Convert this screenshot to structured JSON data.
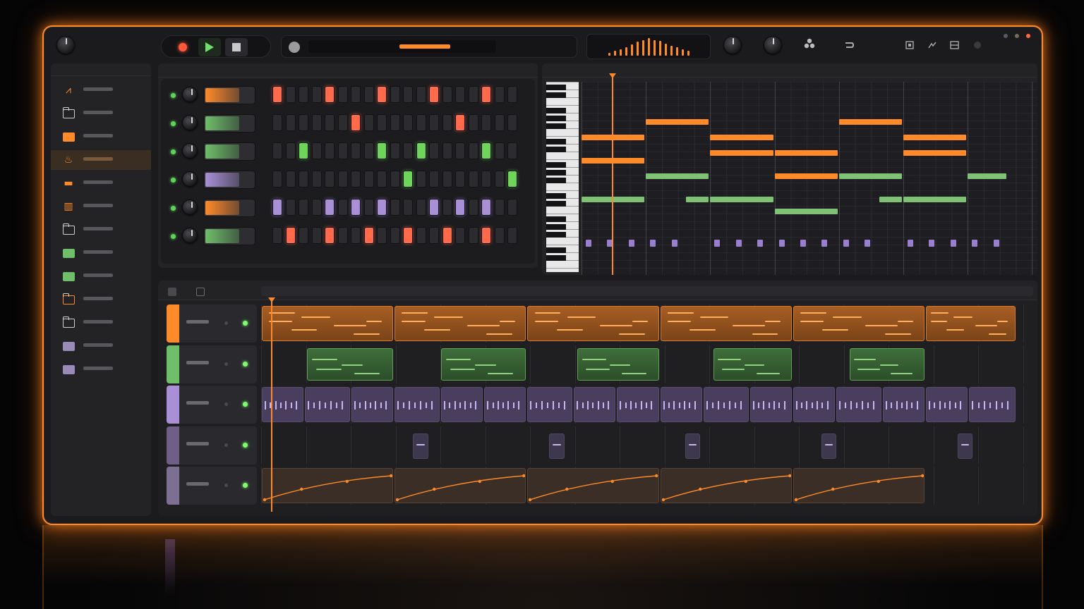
{
  "app": {
    "title": ""
  },
  "colors": {
    "accent": "#ff8a2a",
    "green": "#6fbe6a",
    "purple": "#a88fd6",
    "red": "#ff6b4a",
    "panel": "#232326"
  },
  "transport": {
    "record_icon": "record-icon",
    "play_icon": "play-icon",
    "stop_icon": "stop-icon",
    "position_fraction": 0.62
  },
  "toolbar": {
    "icons": [
      "knob-icon",
      "knob-icon",
      "nodes-icon",
      "loop-icon",
      "window-icon",
      "edit-icon",
      "layout-icon",
      "settings-icon"
    ]
  },
  "meter": {
    "levels": [
      0.15,
      0.25,
      0.35,
      0.45,
      0.6,
      0.75,
      0.85,
      0.95,
      0.85,
      0.8,
      0.65,
      0.55,
      0.45,
      0.35,
      0.25
    ]
  },
  "sidebar": {
    "items": [
      {
        "icon": "waveform-icon",
        "label": "",
        "active": false
      },
      {
        "icon": "folder-icon",
        "label": "",
        "active": false
      },
      {
        "icon": "folder-filled-icon",
        "label": "",
        "active": false
      },
      {
        "icon": "instrument-icon",
        "label": "",
        "active": true
      },
      {
        "icon": "drum-icon",
        "label": "",
        "active": false
      },
      {
        "icon": "piano-icon",
        "label": "",
        "active": false
      },
      {
        "icon": "folder-icon",
        "label": "",
        "active": false
      },
      {
        "icon": "folder-filled-icon",
        "label": "",
        "active": false
      },
      {
        "icon": "folder-filled-icon",
        "label": "",
        "active": false
      },
      {
        "icon": "folder-icon",
        "label": "",
        "active": false
      },
      {
        "icon": "folder-icon",
        "label": "",
        "active": false
      },
      {
        "icon": "folder-filled-icon",
        "label": "",
        "active": false
      },
      {
        "icon": "folder-filled-icon",
        "label": "",
        "active": false
      }
    ]
  },
  "step_sequencer": {
    "channels": [
      {
        "color": "#ff8a2a",
        "steps": [
          1,
          0,
          0,
          0,
          1,
          0,
          0,
          0,
          1,
          0,
          0,
          0,
          1,
          0,
          0,
          0,
          1,
          0,
          0
        ],
        "step_color": "#ff6b4a"
      },
      {
        "color": "#6fbe6a",
        "steps": [
          0,
          0,
          0,
          0,
          0,
          0,
          1,
          0,
          0,
          0,
          0,
          0,
          0,
          0,
          1,
          0,
          0,
          0,
          0
        ],
        "step_color": "#ff6b4a"
      },
      {
        "color": "#6fbe6a",
        "steps": [
          0,
          0,
          1,
          0,
          0,
          0,
          0,
          0,
          1,
          0,
          0,
          1,
          0,
          0,
          0,
          0,
          1,
          0,
          0
        ],
        "step_color": "#6fd45a"
      },
      {
        "color": "#a88fd6",
        "steps": [
          0,
          0,
          0,
          0,
          0,
          0,
          0,
          0,
          0,
          0,
          1,
          0,
          0,
          0,
          0,
          0,
          0,
          0,
          1
        ],
        "step_color": "#6fd45a"
      },
      {
        "color": "#ff8a2a",
        "steps": [
          1,
          0,
          0,
          0,
          1,
          0,
          1,
          0,
          1,
          0,
          0,
          0,
          1,
          0,
          1,
          0,
          1,
          0,
          0
        ],
        "step_color": "#a88fd6"
      },
      {
        "color": "#6fbe6a",
        "steps": [
          0,
          1,
          0,
          0,
          1,
          0,
          0,
          1,
          0,
          0,
          1,
          0,
          0,
          1,
          0,
          0,
          1,
          0,
          0
        ],
        "step_color": "#ff6b4a"
      }
    ]
  },
  "piano_roll": {
    "notes": [
      {
        "start": 0,
        "len": 4,
        "row": 7,
        "color": "#ff8a2a"
      },
      {
        "start": 4,
        "len": 4,
        "row": 5,
        "color": "#ff8a2a"
      },
      {
        "start": 8,
        "len": 4,
        "row": 7,
        "color": "#ff8a2a"
      },
      {
        "start": 8,
        "len": 4,
        "row": 9,
        "color": "#ff8a2a"
      },
      {
        "start": 12,
        "len": 4,
        "row": 9,
        "color": "#ff8a2a"
      },
      {
        "start": 12,
        "len": 4,
        "row": 12,
        "color": "#ff8a2a"
      },
      {
        "start": 16,
        "len": 4,
        "row": 5,
        "color": "#ff8a2a"
      },
      {
        "start": 20,
        "len": 4,
        "row": 7,
        "color": "#ff8a2a"
      },
      {
        "start": 20,
        "len": 4,
        "row": 9,
        "color": "#ff8a2a"
      },
      {
        "start": 0,
        "len": 4,
        "row": 10,
        "color": "#ff8a2a"
      },
      {
        "start": 4,
        "len": 4,
        "row": 12,
        "color": "#7fc275"
      },
      {
        "start": 16,
        "len": 4,
        "row": 12,
        "color": "#7fc275"
      },
      {
        "start": 24,
        "len": 2.5,
        "row": 12,
        "color": "#7fc275"
      },
      {
        "start": 0,
        "len": 4,
        "row": 15,
        "color": "#7fc275"
      },
      {
        "start": 6.5,
        "len": 1.5,
        "row": 15,
        "color": "#7fc275"
      },
      {
        "start": 8,
        "len": 4,
        "row": 15,
        "color": "#7fc275"
      },
      {
        "start": 12,
        "len": 4,
        "row": 16.5,
        "color": "#7fc275"
      },
      {
        "start": 18.5,
        "len": 1.5,
        "row": 15,
        "color": "#7fc275"
      },
      {
        "start": 20,
        "len": 4,
        "row": 15,
        "color": "#7fc275"
      }
    ],
    "hits": [
      0,
      1.33,
      2.66,
      4,
      5.33,
      8,
      9.33,
      10.66,
      12,
      13.33,
      14.66,
      16,
      17.33,
      20,
      21.33,
      22.66,
      24,
      25.33
    ],
    "playhead_beat": 1.9
  },
  "arrangement": {
    "tracks": [
      {
        "color": "#ff8a2a",
        "name": "",
        "clips": [
          [
            0,
            8
          ],
          [
            8,
            16
          ],
          [
            16,
            24
          ],
          [
            24,
            32
          ],
          [
            32,
            40
          ],
          [
            40,
            45.5
          ]
        ],
        "type": "orange"
      },
      {
        "color": "#6fbe6a",
        "name": "",
        "clips": [
          [
            2.7,
            8
          ],
          [
            10.8,
            16
          ],
          [
            19,
            24
          ],
          [
            27.2,
            32
          ],
          [
            35.4,
            40
          ]
        ],
        "type": "green"
      },
      {
        "color": "#a88fd6",
        "name": "",
        "clips": [
          [
            0,
            2.6
          ],
          [
            2.6,
            5.4
          ],
          [
            5.4,
            8
          ],
          [
            8,
            10.8
          ],
          [
            10.8,
            13.4
          ],
          [
            13.4,
            16
          ],
          [
            16,
            18.8
          ],
          [
            18.8,
            21.4
          ],
          [
            21.4,
            24
          ],
          [
            24,
            26.6
          ],
          [
            26.6,
            29.4
          ],
          [
            29.4,
            32
          ],
          [
            32,
            34.6
          ],
          [
            34.6,
            37.4
          ],
          [
            37.4,
            40
          ],
          [
            40,
            42.6
          ],
          [
            42.6,
            45.5
          ]
        ],
        "type": "purple"
      },
      {
        "color": "#6f5f86",
        "name": "",
        "clips": [
          [
            9.1,
            10.1
          ],
          [
            17.3,
            18.3
          ],
          [
            25.5,
            26.5
          ],
          [
            33.7,
            34.7
          ],
          [
            41.9,
            42.9
          ]
        ],
        "type": "small"
      },
      {
        "color": "#7d6f92",
        "name": "",
        "clips": [
          [
            0,
            8
          ],
          [
            8,
            16
          ],
          [
            16,
            24
          ],
          [
            24,
            32
          ],
          [
            32,
            40
          ]
        ],
        "type": "auto"
      }
    ],
    "playhead_beat": 0.6,
    "total_beats": 46.5
  }
}
